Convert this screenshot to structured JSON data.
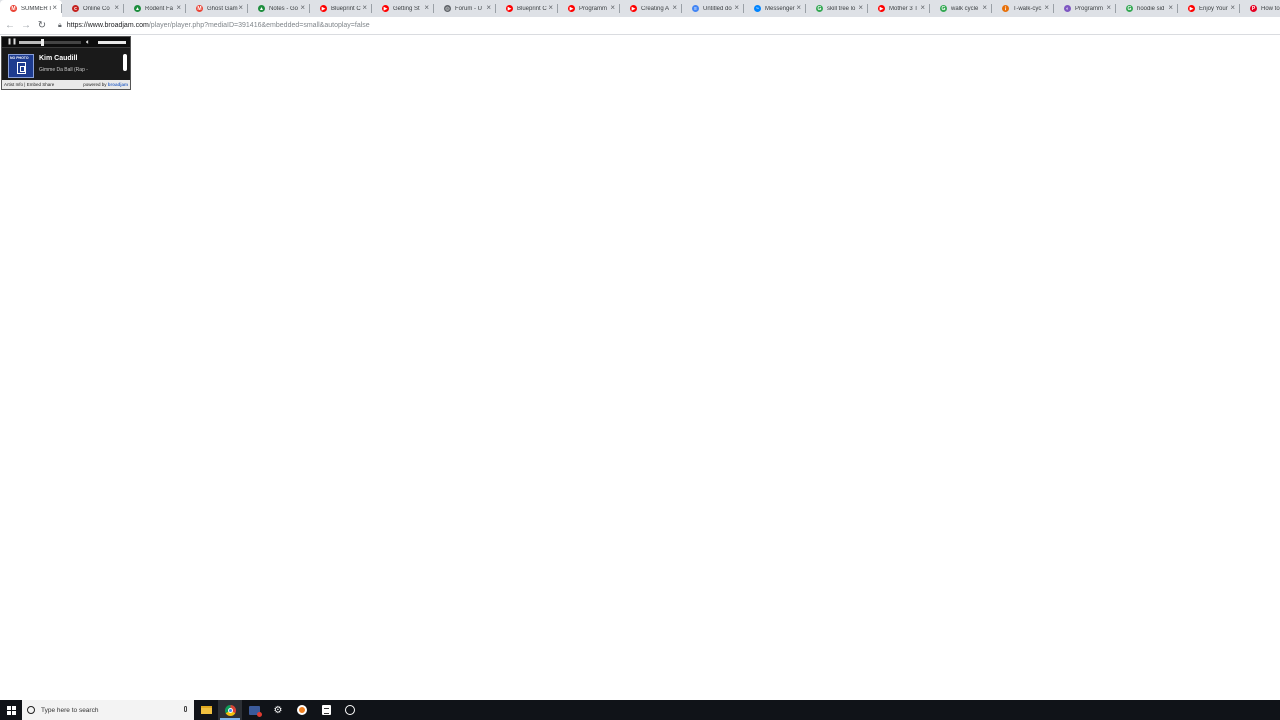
{
  "browser": {
    "tabs": [
      {
        "label": "SUMMER I",
        "favicon": "gmail-icon",
        "color": "#ea4335",
        "glyph": "M"
      },
      {
        "label": "Online Co",
        "favicon": "red-c-icon",
        "color": "#c5221f",
        "glyph": "c"
      },
      {
        "label": "Rodent Fa",
        "favicon": "drive-icon",
        "color": "#1e8e3e",
        "glyph": "▲"
      },
      {
        "label": "Ghost Gam",
        "favicon": "gmail-icon",
        "color": "#ea4335",
        "glyph": "M"
      },
      {
        "label": "Notes - Go",
        "favicon": "drive-icon",
        "color": "#1e8e3e",
        "glyph": "▲"
      },
      {
        "label": "Blueprint C",
        "favicon": "youtube-icon",
        "color": "#ff0000",
        "glyph": "▶"
      },
      {
        "label": "Getting St",
        "favicon": "youtube-icon",
        "color": "#ff0000",
        "glyph": "▶"
      },
      {
        "label": "Forum - U",
        "favicon": "unity-icon",
        "color": "#5f6368",
        "glyph": "◎"
      },
      {
        "label": "Blueprint C",
        "favicon": "youtube-icon",
        "color": "#ff0000",
        "glyph": "▶"
      },
      {
        "label": "Programm",
        "favicon": "youtube-icon",
        "color": "#ff0000",
        "glyph": "▶"
      },
      {
        "label": "Creating A",
        "favicon": "youtube-icon",
        "color": "#ff0000",
        "glyph": "▶"
      },
      {
        "label": "Untitled do",
        "favicon": "docs-icon",
        "color": "#4285f4",
        "glyph": "≡"
      },
      {
        "label": "Messenger",
        "favicon": "messenger-icon",
        "color": "#0084ff",
        "glyph": "~"
      },
      {
        "label": "skill tree lo",
        "favicon": "google-icon",
        "color": "#34a853",
        "glyph": "G"
      },
      {
        "label": "Mother 3 T",
        "favicon": "youtube-icon",
        "color": "#ff0000",
        "glyph": "▶"
      },
      {
        "label": "walk cycle",
        "favicon": "google-icon",
        "color": "#34a853",
        "glyph": "G"
      },
      {
        "label": "T-walk-cyc",
        "favicon": "grid-icon",
        "color": "#e8710a",
        "glyph": "⋮"
      },
      {
        "label": "Programm",
        "favicon": "purple-icon",
        "color": "#7e57c2",
        "glyph": "◐"
      },
      {
        "label": "hoodie sid",
        "favicon": "google-icon",
        "color": "#34a853",
        "glyph": "G"
      },
      {
        "label": "Enjoy Your",
        "favicon": "youtube-icon",
        "color": "#ff0000",
        "glyph": "▶"
      },
      {
        "label": "How to",
        "favicon": "pinterest-icon",
        "color": "#e60023",
        "glyph": "P"
      }
    ],
    "address": {
      "host": "https://www.broadjam.com",
      "path": "/player/player.php?mediaID=391416&embedded=small&autoplay=false"
    }
  },
  "player": {
    "artist": "Kim Caudill",
    "song": "Gimme Da Ball (Rap -",
    "art_label": "NO PHOTO",
    "progress": 0.35,
    "volume": 1.0,
    "footer": {
      "artist_info": "Artist Info",
      "separator": "|",
      "embed": "Embed",
      "share": "Share",
      "powered_by": "powered by",
      "brand": "broadjam"
    }
  },
  "taskbar": {
    "search_placeholder": "Type here to search"
  }
}
